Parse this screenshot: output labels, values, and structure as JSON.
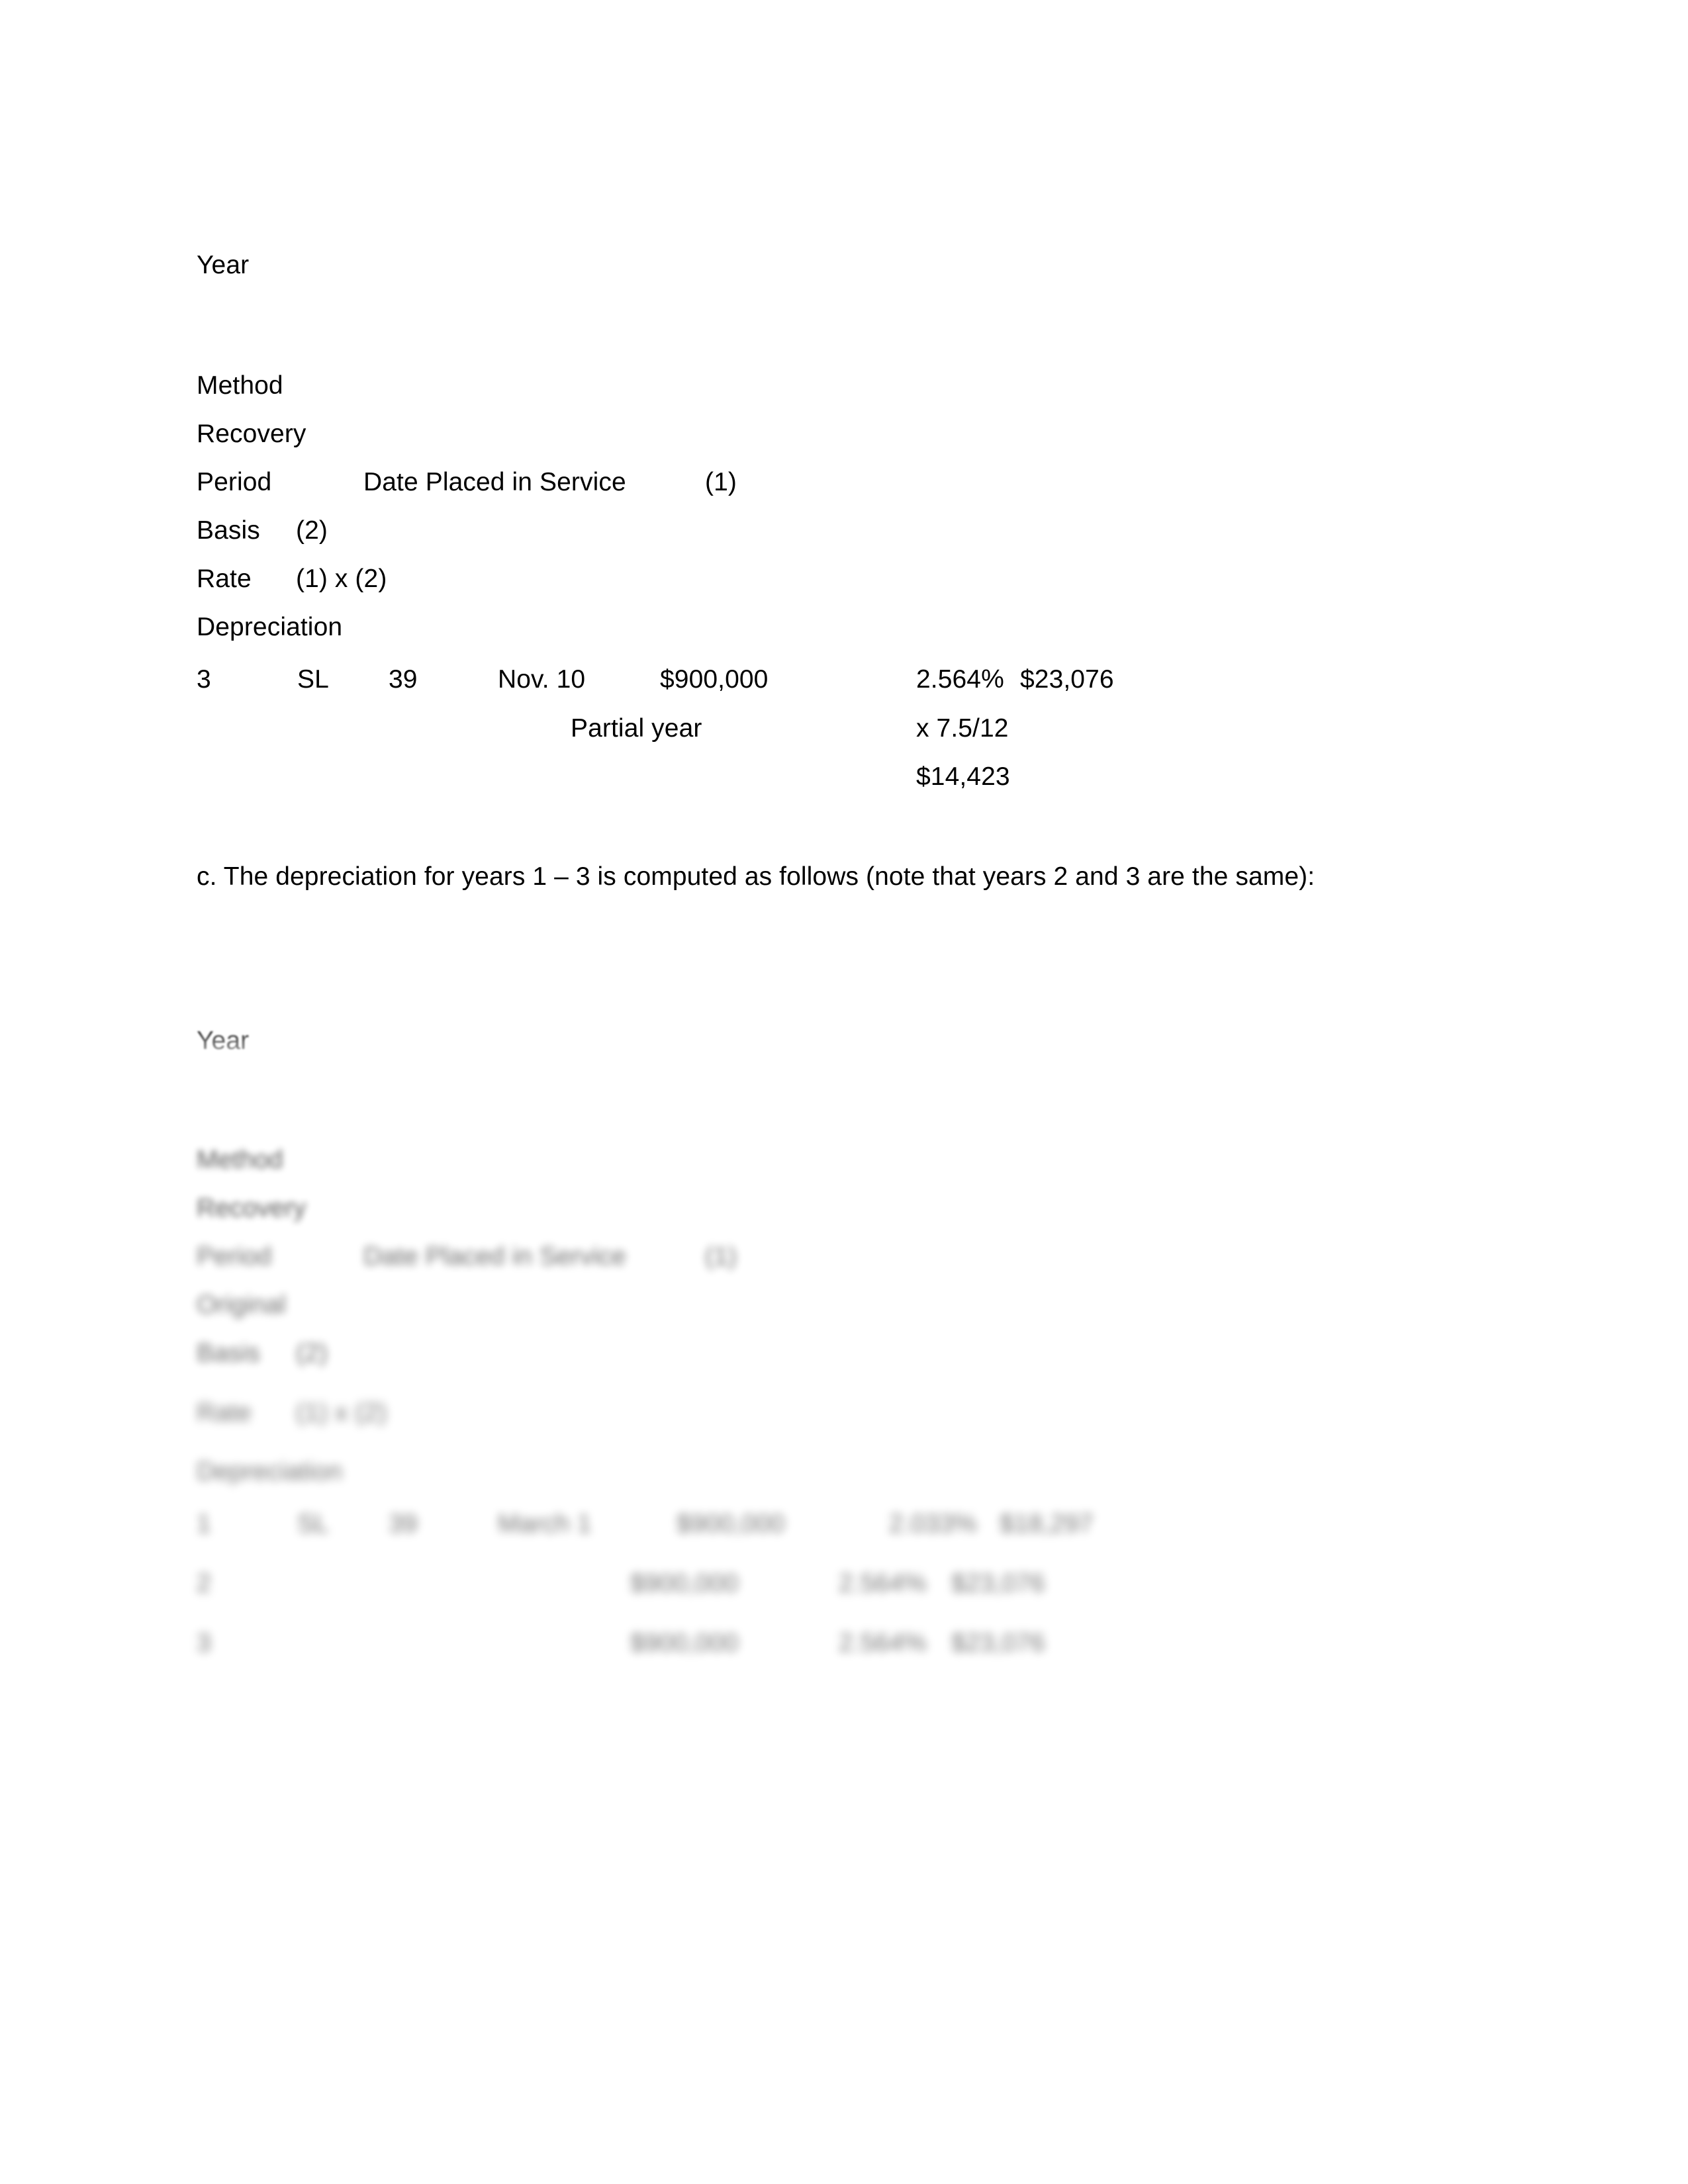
{
  "document": {
    "background_color": "#ffffff",
    "text_color": "#000000"
  },
  "table_b": {
    "headers": {
      "year": "Year",
      "method": "Method",
      "recovery": "Recovery",
      "period": "Period",
      "date_placed_in_service": "Date Placed in Service",
      "col1_ref": "(1)",
      "basis": "Basis",
      "col2_ref": "(2)",
      "rate": "Rate",
      "rate_formula": "(1) x (2)",
      "depreciation": "Depreciation"
    },
    "rows": [
      {
        "year": "3",
        "method": "SL",
        "recovery_period": "39",
        "date_placed_in_service": "Nov. 10",
        "basis": "$900,000",
        "rate": "2.564%",
        "depreciation": "$23,076"
      }
    ],
    "partial_year_label": "Partial year",
    "partial_year_factor": "x 7.5/12",
    "partial_year_total": "$14,423"
  },
  "paragraph_c": {
    "text": "c. The depreciation for years 1 – 3 is computed as follows (note that years 2 and 3 are the same):"
  },
  "table_c": {
    "headers": {
      "year": "Year",
      "method": "Method",
      "recovery": "Recovery",
      "period": "Period",
      "date_placed_in_service": "Date Placed in Service",
      "col1_ref": "(1)",
      "original": "Original",
      "basis": "Basis",
      "col2_ref": "(2)",
      "rate": "Rate",
      "rate_formula": "(1) x (2)",
      "depreciation": "Depreciation"
    },
    "rows": [
      {
        "year": "1",
        "method": "SL",
        "recovery_period": "39",
        "date_placed_in_service": "March 1",
        "basis": "$900,000",
        "rate": "2.033%",
        "depreciation": "$18,297"
      },
      {
        "year": "2",
        "method": "",
        "recovery_period": "",
        "date_placed_in_service": "",
        "basis": "$900,000",
        "rate": "2.564%",
        "depreciation": "$23,076"
      },
      {
        "year": "3",
        "method": "",
        "recovery_period": "",
        "date_placed_in_service": "",
        "basis": "$900,000",
        "rate": "2.564%",
        "depreciation": "$23,076"
      }
    ]
  }
}
